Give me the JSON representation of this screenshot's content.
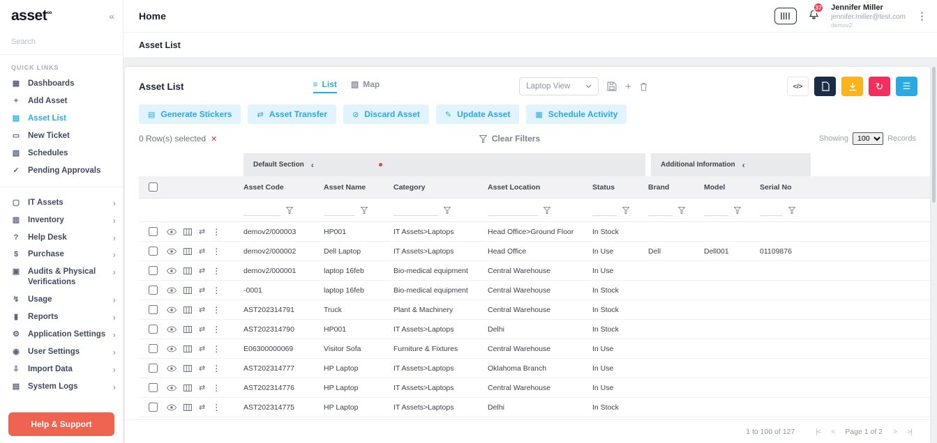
{
  "brand": {
    "logo_text": "asset",
    "logo_mark": "∞"
  },
  "icons": {
    "collapse": "«",
    "chevron_right": "›",
    "section_collapse": "‹",
    "close": "✕",
    "transfer": "⇄",
    "dots": "⋮",
    "refresh": "↻",
    "menu_lines": "☰",
    "code": "</>",
    "plus": "+"
  },
  "sidebar": {
    "search_placeholder": "Search",
    "quick_links_header": "QUICK LINKS",
    "quick_links": [
      {
        "name": "dashboards",
        "icon": "▦",
        "label": "Dashboards",
        "active": false
      },
      {
        "name": "add-asset",
        "icon": "+",
        "label": "Add Asset",
        "active": false
      },
      {
        "name": "asset-list",
        "icon": "▤",
        "label": "Asset List",
        "active": true
      },
      {
        "name": "new-ticket",
        "icon": "▭",
        "label": "New Ticket",
        "active": false
      },
      {
        "name": "schedules",
        "icon": "▧",
        "label": "Schedules",
        "active": false
      },
      {
        "name": "pending-approvals",
        "icon": "✓",
        "label": "Pending Approvals",
        "active": false
      }
    ],
    "menu": [
      {
        "name": "it-assets",
        "icon": "▢",
        "label": "IT Assets"
      },
      {
        "name": "inventory",
        "icon": "▥",
        "label": "Inventory"
      },
      {
        "name": "help-desk",
        "icon": "?",
        "label": "Help Desk"
      },
      {
        "name": "purchase",
        "icon": "$",
        "label": "Purchase"
      },
      {
        "name": "audits-physical-verifications",
        "icon": "▣",
        "label": "Audits & Physical Verifications"
      },
      {
        "name": "usage",
        "icon": "↯",
        "label": "Usage"
      },
      {
        "name": "reports",
        "icon": "▮",
        "label": "Reports"
      },
      {
        "name": "application-settings",
        "icon": "⚙",
        "label": "Application Settings"
      },
      {
        "name": "user-settings",
        "icon": "◉",
        "label": "User Settings"
      },
      {
        "name": "import-data",
        "icon": "⇩",
        "label": "Import Data"
      },
      {
        "name": "system-logs",
        "icon": "▤",
        "label": "System Logs"
      }
    ],
    "help_button": "Help & Support"
  },
  "header": {
    "title": "Home",
    "notification_badge": "37",
    "user": {
      "name": "Jennifer Miller",
      "email": "jennifer.miller@test.com",
      "org": "demov2"
    }
  },
  "subheader": {
    "title": "Asset List"
  },
  "listcard": {
    "title": "Asset List",
    "tabs": [
      {
        "icon": "≡",
        "label": "List"
      },
      {
        "icon": "▧",
        "label": "Map"
      }
    ],
    "view_selector": {
      "value": "Laptop View"
    },
    "selected_info": "0 Row(s) selected",
    "clear_filters": "Clear Filters",
    "showing": {
      "label": "Showing",
      "value": "100",
      "suffix": "Records"
    }
  },
  "toolbar": {
    "buttons": [
      {
        "name": "generate-stickers-button",
        "icon": "▤",
        "label": "Generate Stickers"
      },
      {
        "name": "asset-transfer-button",
        "icon": "⇄",
        "label": "Asset Transfer"
      },
      {
        "name": "discard-asset-button",
        "icon": "⊘",
        "label": "Discard Asset"
      },
      {
        "name": "update-asset-button",
        "icon": "✎",
        "label": "Update Asset"
      },
      {
        "name": "schedule-activity-button",
        "icon": "▦",
        "label": "Schedule Activity"
      }
    ]
  },
  "table": {
    "sections": [
      {
        "label": "Default Section"
      },
      {
        "label": "Additional Information"
      }
    ],
    "columns": [
      "Asset Code",
      "Asset Name",
      "Category",
      "Asset Location",
      "Status",
      "Brand",
      "Model",
      "Serial No"
    ],
    "field_order": [
      "asset_code",
      "asset_name",
      "category",
      "asset_location",
      "status",
      "brand",
      "model",
      "serial_no"
    ],
    "rows": [
      {
        "asset_code": "demov2/000003",
        "asset_name": "HP001",
        "category": "IT Assets>Laptops",
        "asset_location": "Head Office>Ground Floor",
        "status": "In Stock",
        "brand": "",
        "model": "",
        "serial_no": ""
      },
      {
        "asset_code": "demov2/000002",
        "asset_name": "Dell Laptop",
        "category": "IT Assets>Laptops",
        "asset_location": "Head Office",
        "status": "In Use",
        "brand": "Dell",
        "model": "Dell001",
        "serial_no": "01109876"
      },
      {
        "asset_code": "demov2/000001",
        "asset_name": "laptop 16feb",
        "category": "Bio-medical equipment",
        "asset_location": "Central Warehouse",
        "status": "In Use",
        "brand": "",
        "model": "",
        "serial_no": ""
      },
      {
        "asset_code": "-0001",
        "asset_name": "laptop 16feb",
        "category": "Bio-medical equipment",
        "asset_location": "Central Warehouse",
        "status": "In Stock",
        "brand": "",
        "model": "",
        "serial_no": ""
      },
      {
        "asset_code": "AST202314791",
        "asset_name": "Truck",
        "category": "Plant & Machinery",
        "asset_location": "Central Warehouse",
        "status": "In Stock",
        "brand": "",
        "model": "",
        "serial_no": ""
      },
      {
        "asset_code": "AST202314790",
        "asset_name": "HP001",
        "category": "IT Assets>Laptops",
        "asset_location": "Delhi",
        "status": "In Stock",
        "brand": "",
        "model": "",
        "serial_no": ""
      },
      {
        "asset_code": "E06300000069",
        "asset_name": "Visitor Sofa",
        "category": "Furniture & Fixtures",
        "asset_location": "Central Warehouse",
        "status": "In Use",
        "brand": "",
        "model": "",
        "serial_no": ""
      },
      {
        "asset_code": "AST202314777",
        "asset_name": "HP Laptop",
        "category": "IT Assets>Laptops",
        "asset_location": "Oklahoma Branch",
        "status": "In Use",
        "brand": "",
        "model": "",
        "serial_no": ""
      },
      {
        "asset_code": "AST202314776",
        "asset_name": "HP Laptop",
        "category": "IT Assets>Laptops",
        "asset_location": "Central Warehouse",
        "status": "In Use",
        "brand": "",
        "model": "",
        "serial_no": ""
      },
      {
        "asset_code": "AST202314775",
        "asset_name": "HP Laptop",
        "category": "IT Assets>Laptops",
        "asset_location": "Delhi",
        "status": "In Stock",
        "brand": "",
        "model": "",
        "serial_no": ""
      }
    ]
  },
  "footer": {
    "range": "1 to 100 of 127",
    "pager": {
      "first": "|<",
      "prev": "<",
      "label": "Page 1 of 2",
      "next": ">",
      "last": ">|"
    }
  }
}
